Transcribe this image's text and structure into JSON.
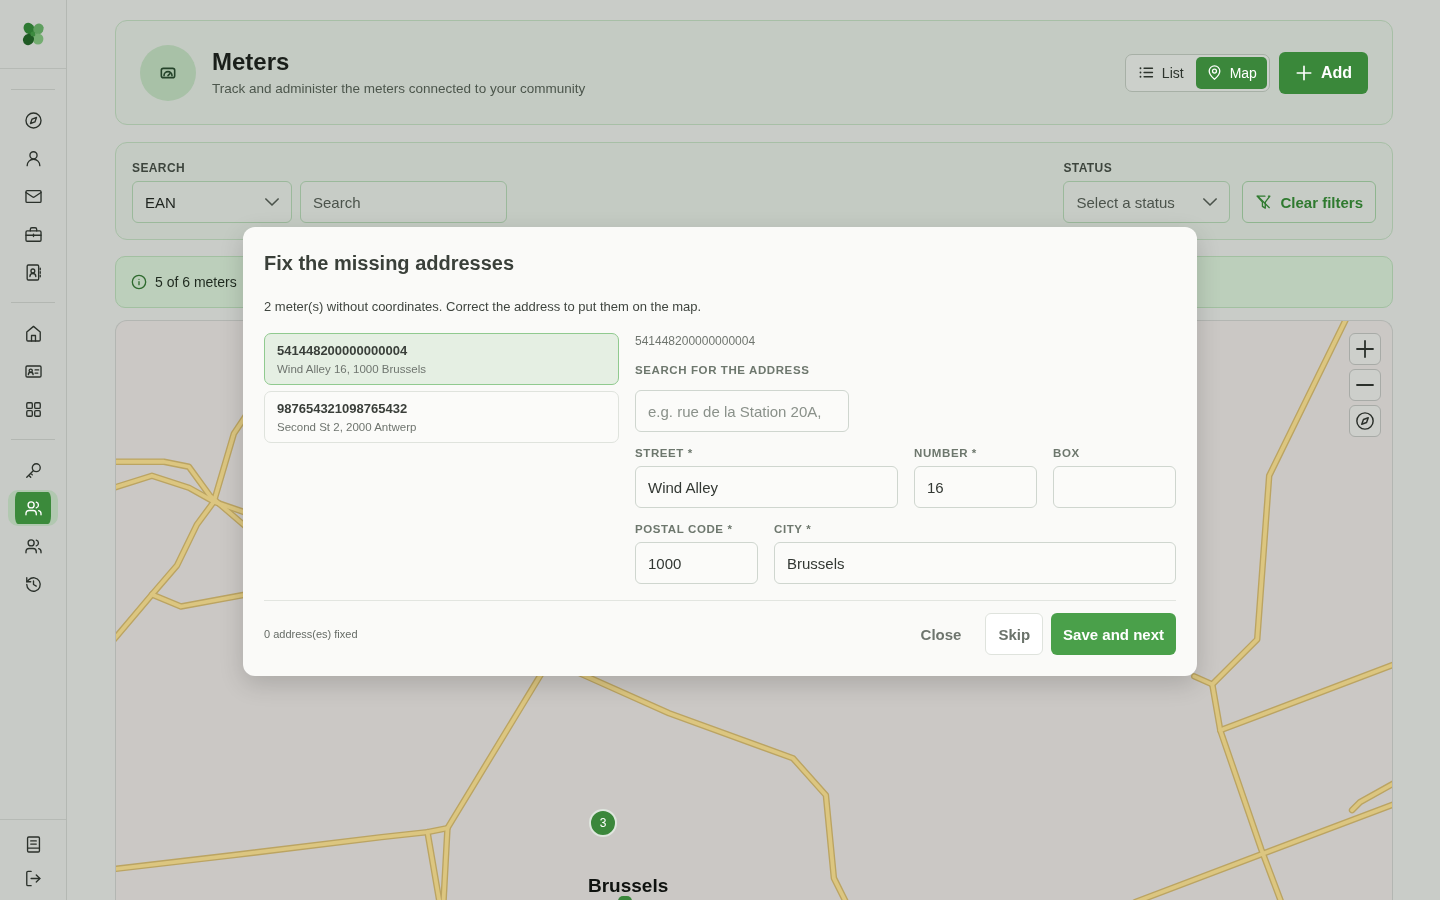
{
  "sidebar": {
    "groups": [
      {
        "items": [
          {
            "selected": false
          },
          {
            "selected": false
          },
          {
            "selected": false
          },
          {
            "selected": false
          },
          {
            "selected": false
          }
        ]
      },
      {
        "items": [
          {
            "selected": false
          },
          {
            "selected": false
          },
          {
            "selected": false
          }
        ]
      },
      {
        "items": [
          {
            "selected": false
          },
          {
            "selected": true
          },
          {
            "selected": false
          },
          {
            "selected": false
          }
        ]
      }
    ],
    "footer_items": [
      {
        "selected": false
      },
      {
        "selected": false
      }
    ]
  },
  "header": {
    "title": "Meters",
    "subtitle": "Track and administer the meters connected to your community",
    "view_toggle": [
      {
        "label": "List",
        "selected": false
      },
      {
        "label": "Map",
        "selected": true
      }
    ],
    "add_button": "Add"
  },
  "filters": {
    "search_label": "SEARCH",
    "search_by": {
      "value": "EAN"
    },
    "search_field": {
      "placeholder": "Search"
    },
    "status_label": "STATUS",
    "status_select": {
      "placeholder": "Select a status"
    },
    "clear_button": "Clear filters"
  },
  "info_banner": {
    "text": "5 of 6 meters"
  },
  "map": {
    "cluster_marker": {
      "count": "3"
    },
    "place_label": "Brussels"
  },
  "modal": {
    "title": "Fix the missing addresses",
    "subtitle": "2 meter(s) without coordinates. Correct the address to put them on the map.",
    "meters": [
      {
        "ean": "541448200000000004",
        "address": "Wind Alley 16, 1000 Brussels",
        "selected": true
      },
      {
        "ean": "987654321098765432",
        "address": "Second St 2, 2000 Antwerp",
        "selected": false
      }
    ],
    "current_ean": "541448200000000004",
    "address_search": {
      "label": "SEARCH FOR THE ADDRESS",
      "placeholder": "e.g. rue de la Station 20A,"
    },
    "address_rows": [
      {
        "fields": [
          {
            "label": "STREET *",
            "value": "Wind Alley"
          },
          {
            "label": "NUMBER *",
            "value": "16"
          },
          {
            "label": "BOX"
          }
        ]
      },
      {
        "fields": [
          {
            "label": "POSTAL CODE *",
            "value": "1000"
          },
          {
            "label": "CITY *",
            "value": "Brussels"
          }
        ]
      }
    ],
    "status": "0 address(es) fixed",
    "buttons": [
      {
        "label": "Close",
        "kind": "text"
      },
      {
        "label": "Skip",
        "kind": "outline"
      },
      {
        "label": "Save and next",
        "kind": "primary"
      }
    ]
  }
}
